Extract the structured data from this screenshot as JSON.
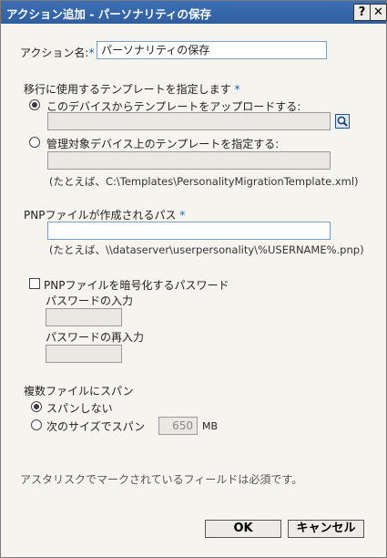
{
  "titlebar": {
    "title": "アクション追加 - パーソナリティの保存",
    "help": "?",
    "close": "✕"
  },
  "action_name": {
    "label": "アクション名:",
    "required": "*",
    "value": "パーソナリティの保存"
  },
  "template_section": {
    "label": "移行に使用するテンプレートを指定します",
    "required": "*",
    "upload_option": {
      "label": "このデバイスからテンプレートをアップロードする:",
      "selected": true,
      "value": ""
    },
    "managed_option": {
      "label": "管理対象デバイス上のテンプレートを指定する:",
      "selected": false,
      "value": ""
    },
    "example": "(たとえば、C:\\Templates\\PersonalityMigrationTemplate.xml)"
  },
  "pnp_path": {
    "label": "PNPファイルが作成されるパス",
    "required": "*",
    "value": "",
    "example": "(たとえば、\\\\dataserver\\userpersonality\\%USERNAME%.pnp)"
  },
  "encrypt": {
    "label": "PNPファイルを暗号化するパスワード",
    "checked": false,
    "password_label": "パスワードの入力",
    "password_value": "",
    "reenter_label": "パスワードの再入力",
    "reenter_value": ""
  },
  "span": {
    "label": "複数ファイルにスパン",
    "no_span_label": "スパンしない",
    "no_span_selected": true,
    "size_span_label": "次のサイズでスパン",
    "size_value": "650",
    "unit": "MB"
  },
  "footer_note": "アスタリスクでマークされているフィールドは必須です。",
  "buttons": {
    "ok": "OK",
    "cancel": "キャンセル"
  },
  "colors": {
    "titlebar": "#3d6fb5",
    "required": "#1f5fb5",
    "background": "#f5f4ef"
  },
  "icons": {
    "browse": "magnifier-icon",
    "help": "question-icon",
    "close": "close-icon"
  }
}
